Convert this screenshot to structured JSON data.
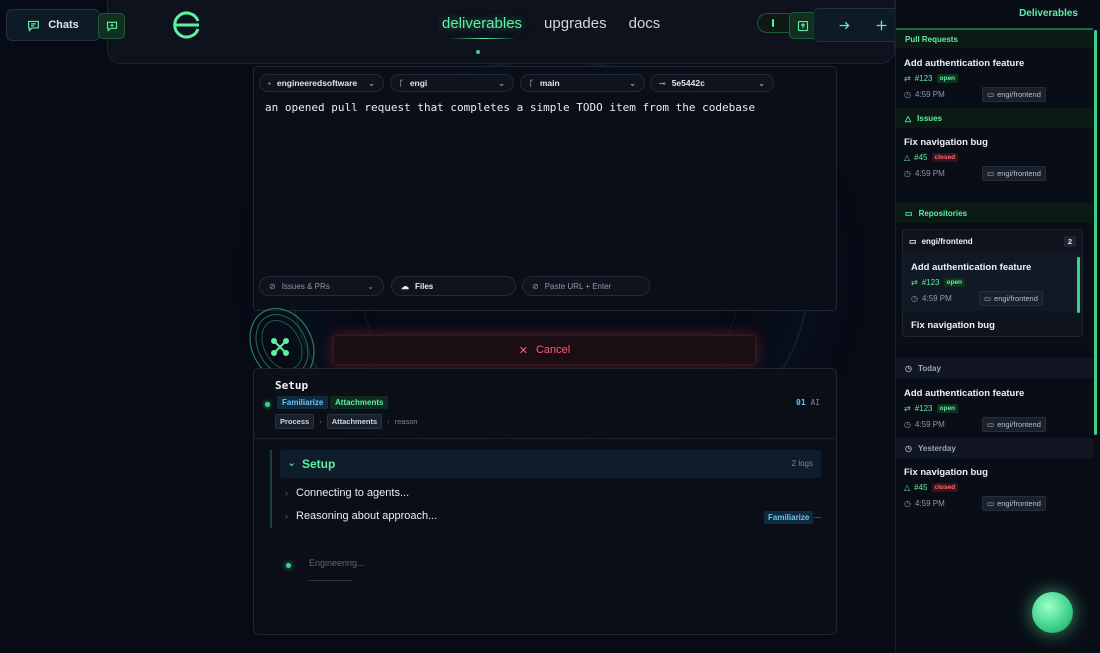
{
  "header": {
    "chats_label": "Chats",
    "nav_tabs": [
      {
        "label": "deliverables",
        "active": true
      },
      {
        "label": "upgrades",
        "active": false
      },
      {
        "label": "docs",
        "active": false
      }
    ]
  },
  "composer": {
    "selectors": [
      {
        "icon": "repo-icon",
        "label": "engineeredsoftware"
      },
      {
        "icon": "branch-icon",
        "label": "engi"
      },
      {
        "icon": "branch-icon",
        "label": "main"
      },
      {
        "icon": "commit-icon",
        "label": "5e5442c"
      }
    ],
    "prompt": "an opened pull request that completes a simple TODO item from the codebase",
    "bottom": {
      "issues_prs": "Issues & PRs",
      "files": "Files",
      "paste_url_placeholder": "Paste URL + Enter"
    }
  },
  "cancel_label": "Cancel",
  "setup": {
    "title": "Setup",
    "tags": [
      "Familiarize",
      "Attachments"
    ],
    "breadcrumb": [
      "Process",
      "Attachments",
      "reason"
    ],
    "ai_count": "01",
    "ai_label": "AI",
    "log_group": {
      "title": "Setup",
      "count": "2 logs"
    },
    "logs": [
      "Connecting to agents...",
      "Reasoning about approach..."
    ],
    "log_badge": "Familiarize",
    "engineering_text": "Engineering..."
  },
  "sidebar": {
    "title": "Deliverables",
    "sections": {
      "pull_requests": "Pull Requests",
      "issues": "Issues",
      "repositories": "Repositories",
      "today": "Today",
      "yesterday": "Yesterday"
    },
    "pr_card": {
      "title": "Add authentication feature",
      "number": "#123",
      "status": "open",
      "time": "4:59 PM",
      "repo": "engi/frontend"
    },
    "issue_card": {
      "title": "Fix navigation bug",
      "number": "#45",
      "status": "closed",
      "time": "4:59 PM",
      "repo": "engi/frontend"
    },
    "repo_group": {
      "name": "engi/frontend",
      "count": "2"
    },
    "repo_items": [
      {
        "title": "Add authentication feature",
        "number": "#123",
        "status": "open",
        "time": "4:59 PM",
        "repo": "engi/frontend"
      },
      {
        "title": "Fix navigation bug"
      }
    ],
    "today_card": {
      "title": "Add authentication feature",
      "number": "#123",
      "status": "open",
      "time": "4:59 PM",
      "repo": "engi/frontend"
    },
    "yesterday_card": {
      "title": "Fix navigation bug",
      "number": "#45",
      "status": "closed",
      "time": "4:59 PM",
      "repo": "engi/frontend"
    }
  },
  "colors": {
    "accent": "#5ef0a0",
    "danger": "#ff5d6c",
    "info": "#6fc3f0",
    "background": "#070b16"
  }
}
